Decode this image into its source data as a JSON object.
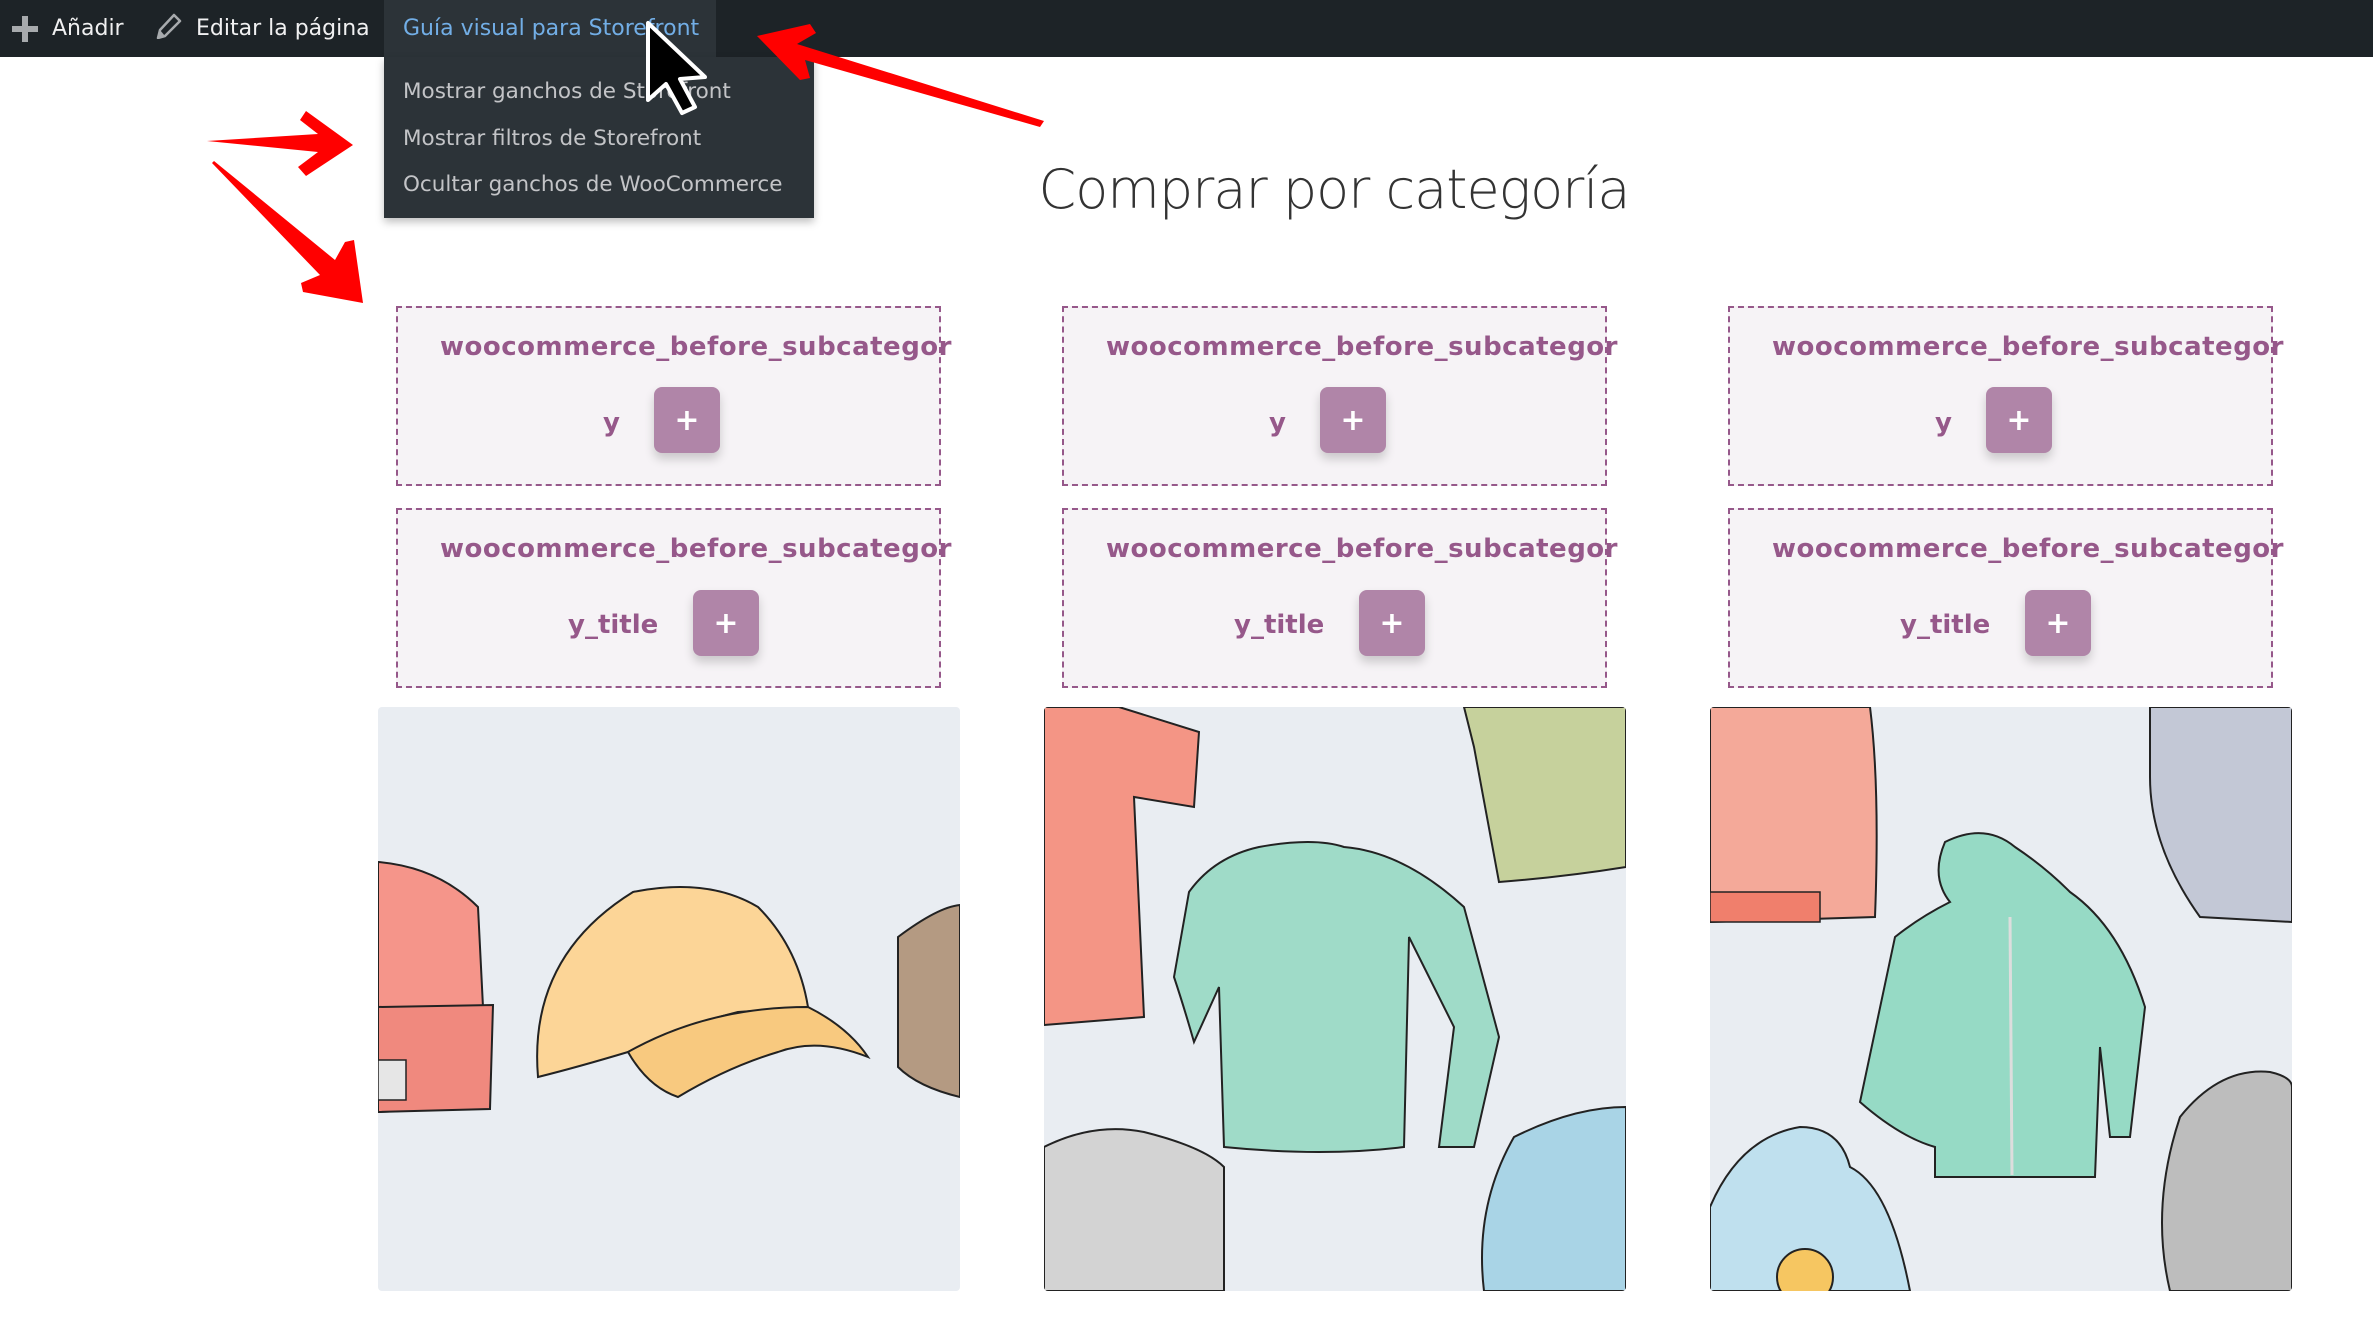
{
  "adminbar": {
    "add_label": "Añadir",
    "add_icon": "plus-icon",
    "edit_label": "Editar la página",
    "edit_icon": "pencil-icon",
    "guide_label": "Guía visual para Storefront"
  },
  "dropdown": {
    "items": [
      {
        "label": "Mostrar ganchos de Storefront"
      },
      {
        "label": "Mostrar filtros de Storefront"
      },
      {
        "label": "Ocultar ganchos de WooCommerce"
      }
    ]
  },
  "main": {
    "heading": "Comprar por categoría",
    "columns": [
      {
        "hooks": [
          {
            "name_line1": "woocommerce_before_subcategor",
            "name_line2": "y",
            "button": "+"
          },
          {
            "name_line1": "woocommerce_before_subcategor",
            "name_line2": "y_title",
            "button": "+"
          }
        ],
        "image": "accessories-hats-illustration"
      },
      {
        "hooks": [
          {
            "name_line1": "woocommerce_before_subcategor",
            "name_line2": "y",
            "button": "+"
          },
          {
            "name_line1": "woocommerce_before_subcategor",
            "name_line2": "y_title",
            "button": "+"
          }
        ],
        "image": "tshirts-illustration"
      },
      {
        "hooks": [
          {
            "name_line1": "woocommerce_before_subcategor",
            "name_line2": "y",
            "button": "+"
          },
          {
            "name_line1": "woocommerce_before_subcategor",
            "name_line2": "y_title",
            "button": "+"
          }
        ],
        "image": "hoodies-illustration"
      }
    ]
  },
  "colors": {
    "adminbar_bg": "#1d2327",
    "dropdown_bg": "#2c3338",
    "active_link": "#72aee6",
    "hook_accent": "#96588a",
    "hook_button": "#b085a8",
    "annotation_arrow": "#ff0000"
  }
}
